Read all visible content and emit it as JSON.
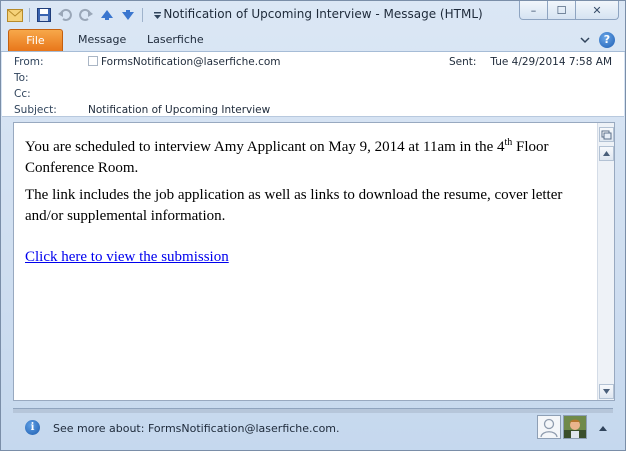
{
  "window": {
    "title": "Notification of Upcoming Interview  -  Message (HTML)",
    "controls": {
      "minimize": "–",
      "maximize": "☐",
      "close": "✕"
    }
  },
  "quick_access": [
    "mail-icon",
    "save-icon",
    "undo-icon",
    "redo-icon",
    "previous-item-icon",
    "next-item-icon",
    "customize-qat-icon"
  ],
  "ribbon": {
    "tabs": [
      "File",
      "Message",
      "Laserfiche"
    ],
    "active_tab": "File",
    "file_tab_color": "#e8761a"
  },
  "header": {
    "from_label": "From:",
    "from_value": "FormsNotification@laserfiche.com",
    "to_label": "To:",
    "to_value": "",
    "cc_label": "Cc:",
    "cc_value": "",
    "subject_label": "Subject:",
    "subject_value": "Notification of Upcoming Interview",
    "sent_label": "Sent:",
    "sent_value": "Tue 4/29/2014 7:58 AM"
  },
  "body": {
    "p1_before": "You are scheduled to interview Amy Applicant on May 9, 2014 at 11am in the 4",
    "p1_sup": "th",
    "p1_after": " Floor Conference Room.",
    "p2": "The link includes the job application as well as links to download the resume, cover letter and/or supplemental information.",
    "link": "Click here to view the submission"
  },
  "people_pane": {
    "text": "See more about: FormsNotification@laserfiche.com."
  },
  "colors": {
    "link": "#0000ee",
    "chrome": "#cfdef0"
  }
}
